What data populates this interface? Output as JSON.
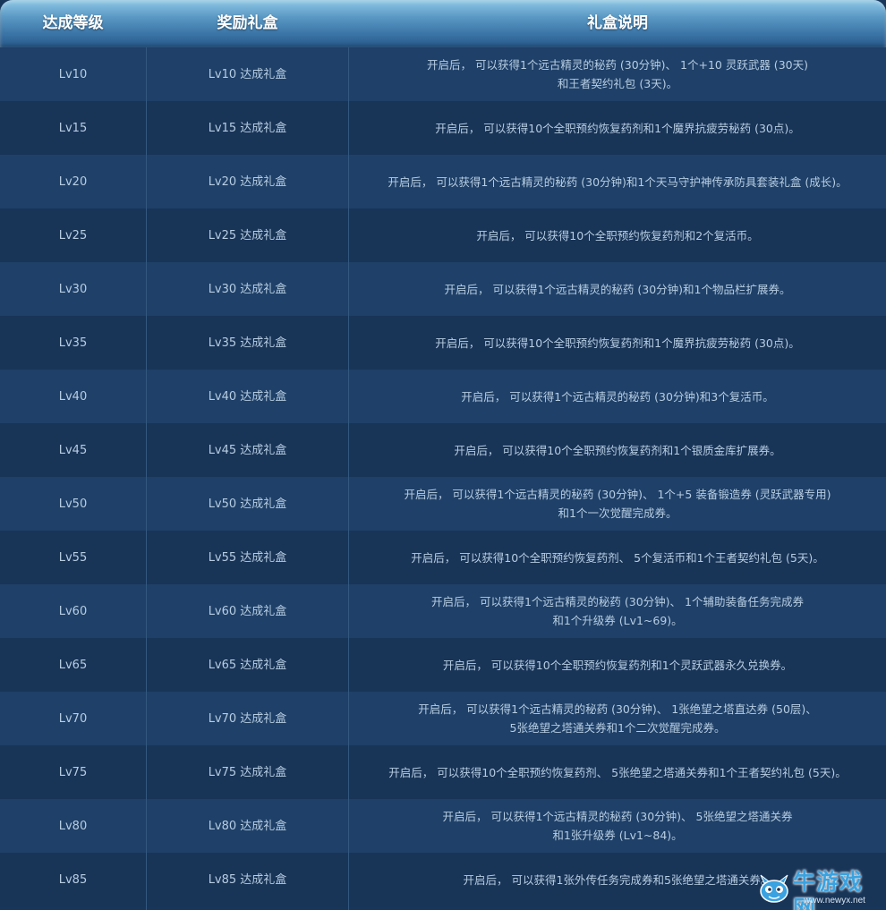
{
  "header": {
    "col1": "达成等级",
    "col2": "奖励礼盒",
    "col3": "礼盒说明"
  },
  "rows": [
    {
      "level": "Lv10",
      "box": "Lv10 达成礼盒",
      "desc": [
        "开启后， 可以获得1个远古精灵的秘药 (30分钟)、 1个+10 灵跃武器 (30天)",
        "和王者契约礼包 (3天)。"
      ]
    },
    {
      "level": "Lv15",
      "box": "Lv15 达成礼盒",
      "desc": [
        "开启后， 可以获得10个全职预约恢复药剂和1个魔界抗疲劳秘药 (30点)。"
      ]
    },
    {
      "level": "Lv20",
      "box": "Lv20 达成礼盒",
      "desc": [
        "开启后， 可以获得1个远古精灵的秘药 (30分钟)和1个天马守护神传承防具套装礼盒 (成长)。"
      ]
    },
    {
      "level": "Lv25",
      "box": "Lv25 达成礼盒",
      "desc": [
        "开启后， 可以获得10个全职预约恢复药剂和2个复活币。"
      ]
    },
    {
      "level": "Lv30",
      "box": "Lv30 达成礼盒",
      "desc": [
        "开启后， 可以获得1个远古精灵的秘药 (30分钟)和1个物品栏扩展券。"
      ]
    },
    {
      "level": "Lv35",
      "box": "Lv35 达成礼盒",
      "desc": [
        "开启后， 可以获得10个全职预约恢复药剂和1个魔界抗疲劳秘药 (30点)。"
      ]
    },
    {
      "level": "Lv40",
      "box": "Lv40 达成礼盒",
      "desc": [
        "开启后， 可以获得1个远古精灵的秘药 (30分钟)和3个复活币。"
      ]
    },
    {
      "level": "Lv45",
      "box": "Lv45 达成礼盒",
      "desc": [
        "开启后， 可以获得10个全职预约恢复药剂和1个银质金库扩展券。"
      ]
    },
    {
      "level": "Lv50",
      "box": "Lv50 达成礼盒",
      "desc": [
        "开启后， 可以获得1个远古精灵的秘药 (30分钟)、 1个+5 装备锻造券 (灵跃武器专用)",
        "和1个一次觉醒完成券。"
      ]
    },
    {
      "level": "Lv55",
      "box": "Lv55 达成礼盒",
      "desc": [
        "开启后， 可以获得10个全职预约恢复药剂、 5个复活币和1个王者契约礼包 (5天)。"
      ]
    },
    {
      "level": "Lv60",
      "box": "Lv60 达成礼盒",
      "desc": [
        "开启后， 可以获得1个远古精灵的秘药 (30分钟)、 1个辅助装备任务完成券",
        "和1个升级券 (Lv1~69)。"
      ]
    },
    {
      "level": "Lv65",
      "box": "Lv65 达成礼盒",
      "desc": [
        "开启后， 可以获得10个全职预约恢复药剂和1个灵跃武器永久兑换券。"
      ]
    },
    {
      "level": "Lv70",
      "box": "Lv70 达成礼盒",
      "desc": [
        "开启后， 可以获得1个远古精灵的秘药 (30分钟)、 1张绝望之塔直达券 (50层)、",
        "5张绝望之塔通关券和1个二次觉醒完成券。"
      ]
    },
    {
      "level": "Lv75",
      "box": "Lv75 达成礼盒",
      "desc": [
        "开启后， 可以获得10个全职预约恢复药剂、 5张绝望之塔通关券和1个王者契约礼包 (5天)。"
      ]
    },
    {
      "level": "Lv80",
      "box": "Lv80 达成礼盒",
      "desc": [
        "开启后， 可以获得1个远古精灵的秘药 (30分钟)、 5张绝望之塔通关券",
        "和1张升级券 (Lv1~84)。"
      ]
    },
    {
      "level": "Lv85",
      "box": "Lv85 达成礼盒",
      "desc": [
        "开启后， 可以获得1张外传任务完成券和5张绝望之塔通关券。"
      ]
    }
  ],
  "watermark": {
    "text": "牛游戏网",
    "url": "www.newyx.net",
    "mascot_icon": "dragon-mascot-icon"
  },
  "colors": {
    "row_odd": "#1f4068",
    "row_even": "#183457",
    "text": "#b7cde2",
    "header_text": "#ffffff"
  }
}
